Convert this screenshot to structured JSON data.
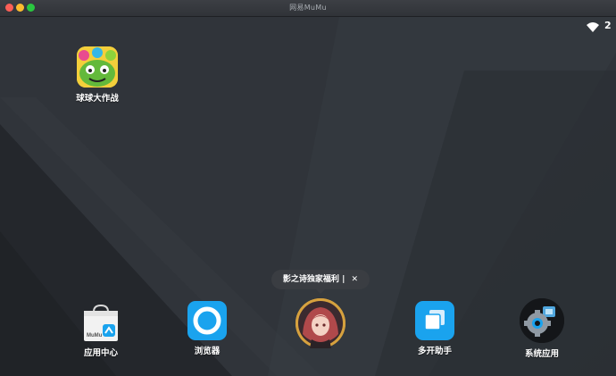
{
  "window": {
    "title": "网易MuMu"
  },
  "status_bar": {
    "wifi_icon": "wifi-icon",
    "text": "2"
  },
  "desktop": {
    "apps": [
      {
        "label": "球球大作战",
        "icon": "ball-battle-game-icon"
      }
    ]
  },
  "dock": {
    "apps": [
      {
        "label": "应用中心",
        "icon": "app-center-bag-icon",
        "icon_text": "MuMu"
      },
      {
        "label": "浏览器",
        "icon": "browser-icon"
      },
      {
        "label": "多开助手",
        "icon": "multi-instance-icon"
      },
      {
        "label": "系统应用",
        "icon": "system-apps-gear-icon"
      }
    ],
    "promo": {
      "tooltip": "影之诗独家福利",
      "separator": "|",
      "close": "✕",
      "icon": "anime-girl-avatar-icon"
    }
  },
  "colors": {
    "wallpaper": "#2a2e33",
    "accent": "#1aa3ee",
    "tooltip_bg": "#3a3d42"
  }
}
